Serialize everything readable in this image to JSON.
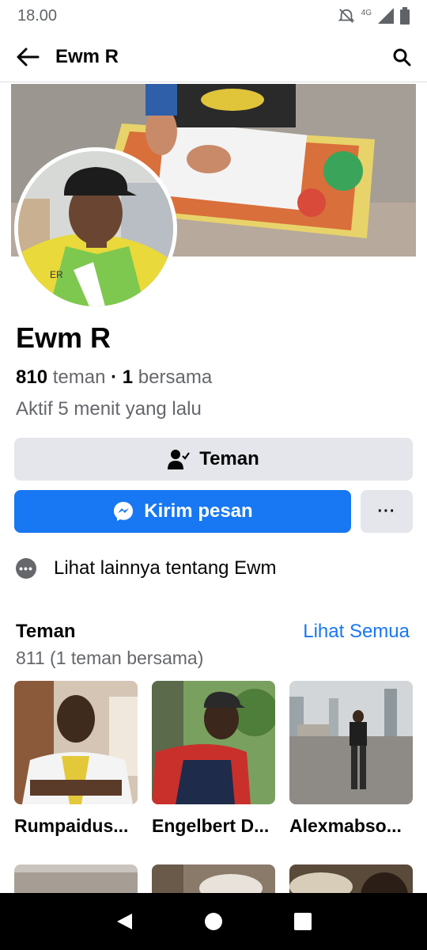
{
  "status_bar": {
    "time": "18.00",
    "network": "4G"
  },
  "app_bar": {
    "title": "Ewm R"
  },
  "profile": {
    "name": "Ewm R",
    "friend_count": "810",
    "friend_label": "teman",
    "separator": "·",
    "mutual_count": "1",
    "mutual_label": "bersama",
    "activity": "Aktif 5 menit yang lalu"
  },
  "actions": {
    "friend_button": "Teman",
    "message_button": "Kirim pesan",
    "more_button": "···"
  },
  "about": {
    "label": "Lihat lainnya tentang Ewm"
  },
  "friends": {
    "title": "Teman",
    "see_all": "Lihat Semua",
    "count": "811 (1 teman bersama)",
    "items": [
      {
        "name": "Rumpaidus..."
      },
      {
        "name": "Engelbert D..."
      },
      {
        "name": "Alexmabso..."
      }
    ]
  },
  "colors": {
    "accent": "#1877f2",
    "button_gray": "#e4e6eb",
    "secondary_text": "#65676b"
  }
}
